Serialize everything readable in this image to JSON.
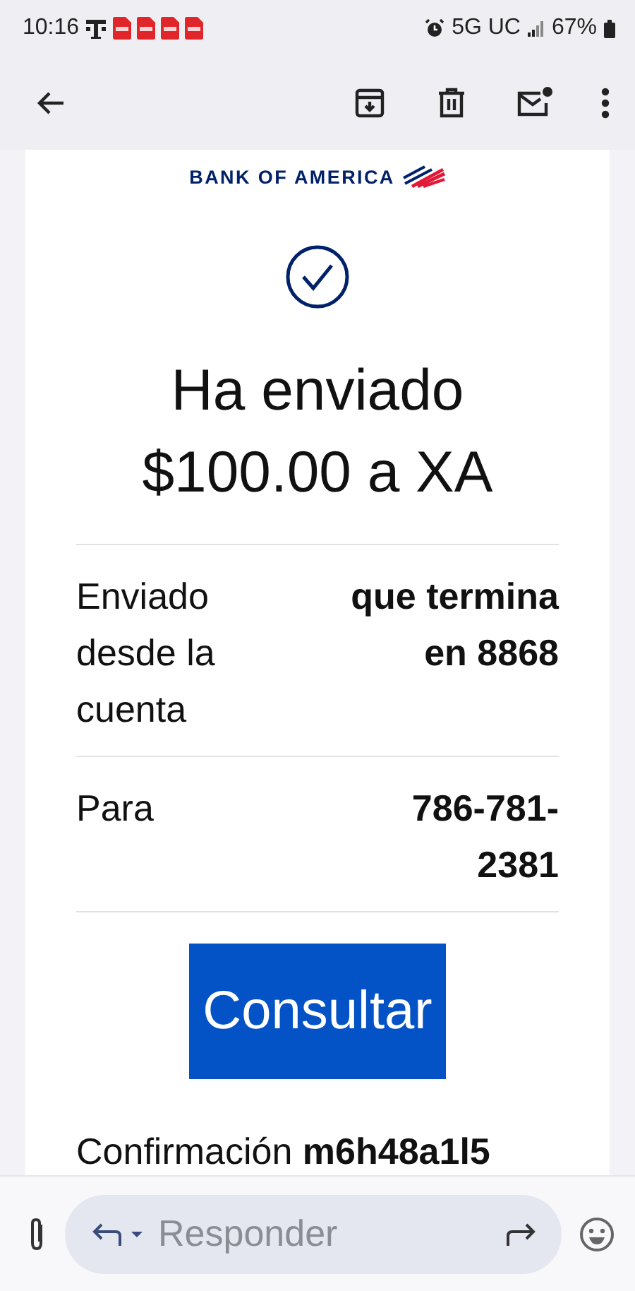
{
  "status_bar": {
    "time": "10:16",
    "notifications": [
      {
        "kind": "carrier"
      },
      {
        "kind": "pdf"
      },
      {
        "kind": "pdf"
      },
      {
        "kind": "pdf"
      },
      {
        "kind": "pdf"
      }
    ],
    "network": "5G UC",
    "battery": "67%"
  },
  "email": {
    "brand": "BANK OF AMERICA",
    "headline": "Ha enviado $100.00 a XA",
    "details": [
      {
        "label": "Enviado desde la cuenta",
        "value": "que termina en 8868"
      },
      {
        "label": "Para",
        "value": "786-781-2381"
      }
    ],
    "button": "Consultar",
    "confirmation": "Confirmación **m6h48a1l5**"
  },
  "compose": {
    "placeholder": "Responder"
  }
}
